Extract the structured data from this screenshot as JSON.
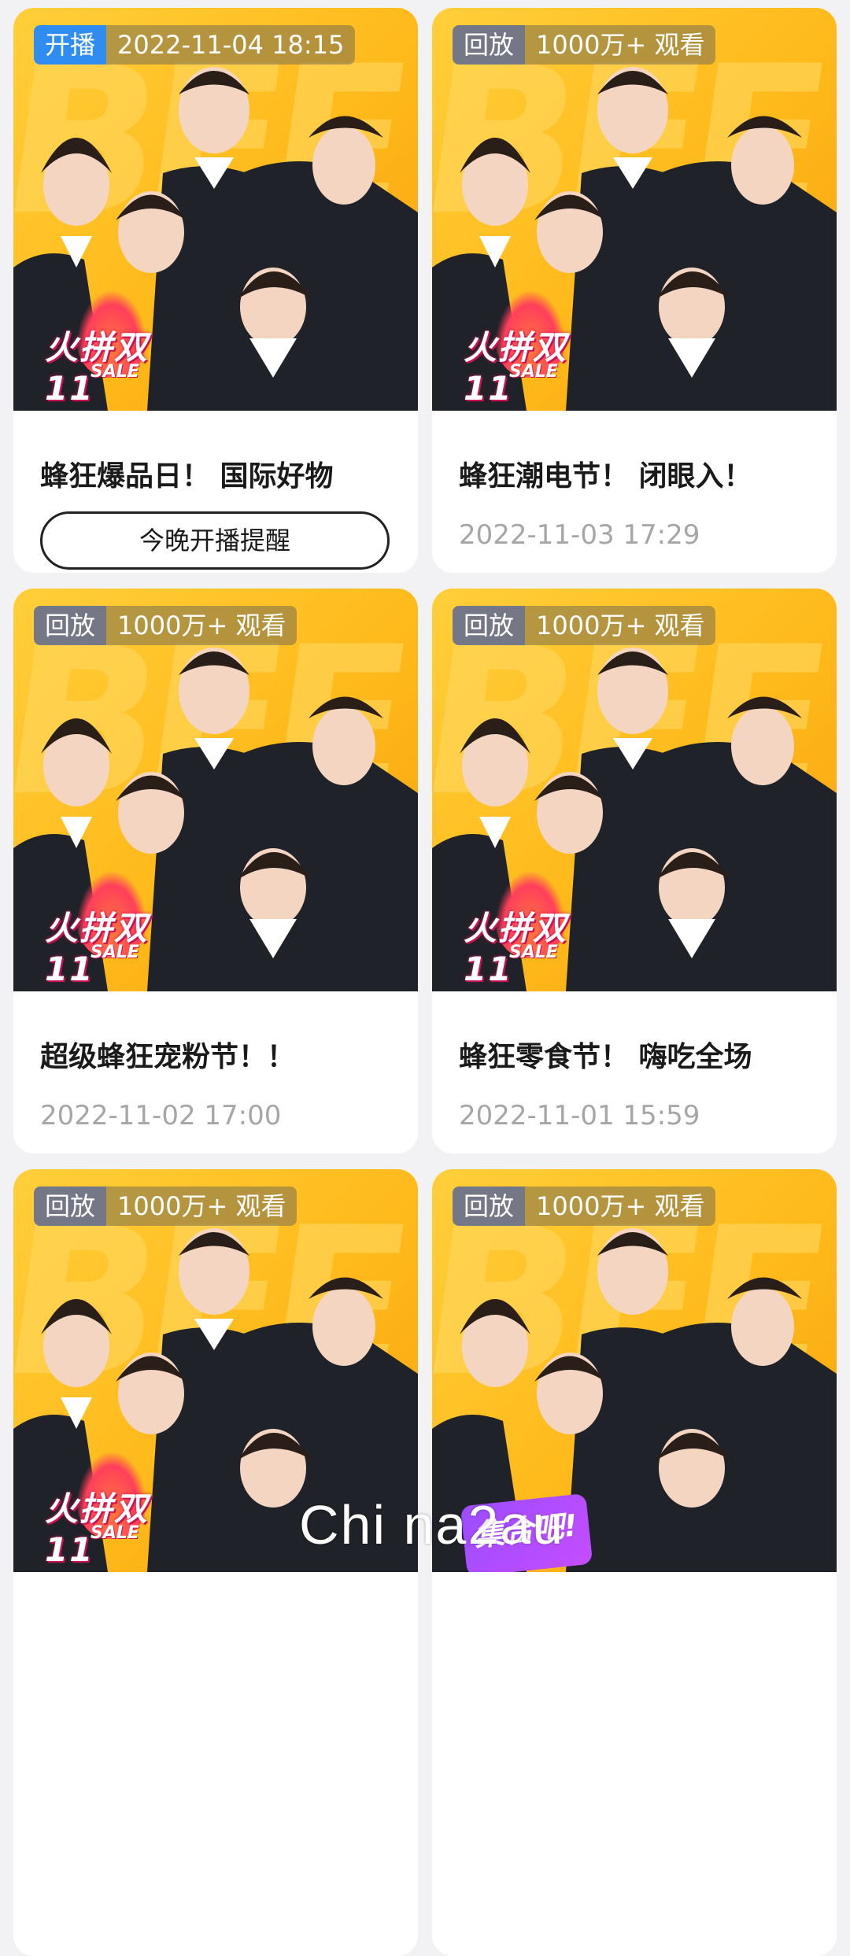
{
  "cards": [
    {
      "tag": "开播",
      "tag_type": "live",
      "info": "2022-11-04 18:15",
      "title": "蜂狂爆品日！ 国际好物",
      "action_label": "今晚开播提醒",
      "meta": null,
      "sale_title": "火拼双11",
      "sale_sub": "SALE"
    },
    {
      "tag": "回放",
      "tag_type": "replay",
      "info": "1000万+ 观看",
      "title": "蜂狂潮电节！ 闭眼入！",
      "action_label": null,
      "meta": "2022-11-03 17:29",
      "sale_title": "火拼双11",
      "sale_sub": "SALE"
    },
    {
      "tag": "回放",
      "tag_type": "replay",
      "info": "1000万+ 观看",
      "title": "超级蜂狂宠粉节！！",
      "action_label": null,
      "meta": "2022-11-02 17:00",
      "sale_title": "火拼双11",
      "sale_sub": "SALE"
    },
    {
      "tag": "回放",
      "tag_type": "replay",
      "info": "1000万+ 观看",
      "title": "蜂狂零食节！ 嗨吃全场",
      "action_label": null,
      "meta": "2022-11-01 15:59",
      "sale_title": "火拼双11",
      "sale_sub": "SALE"
    },
    {
      "tag": "回放",
      "tag_type": "replay",
      "info": "1000万+ 观看",
      "sale_title": "火拼双11",
      "sale_sub": "SALE"
    },
    {
      "tag": "回放",
      "tag_type": "replay",
      "info": "1000万+ 观看",
      "sale_title": "集合吧!"
    }
  ],
  "watermark": "Chi na2au",
  "colors": {
    "thumb_bg": "#ffb91a",
    "live_tag": "#2f8cf0",
    "replay_tag": "#5c6894",
    "meta_text": "#a6a6a6"
  }
}
